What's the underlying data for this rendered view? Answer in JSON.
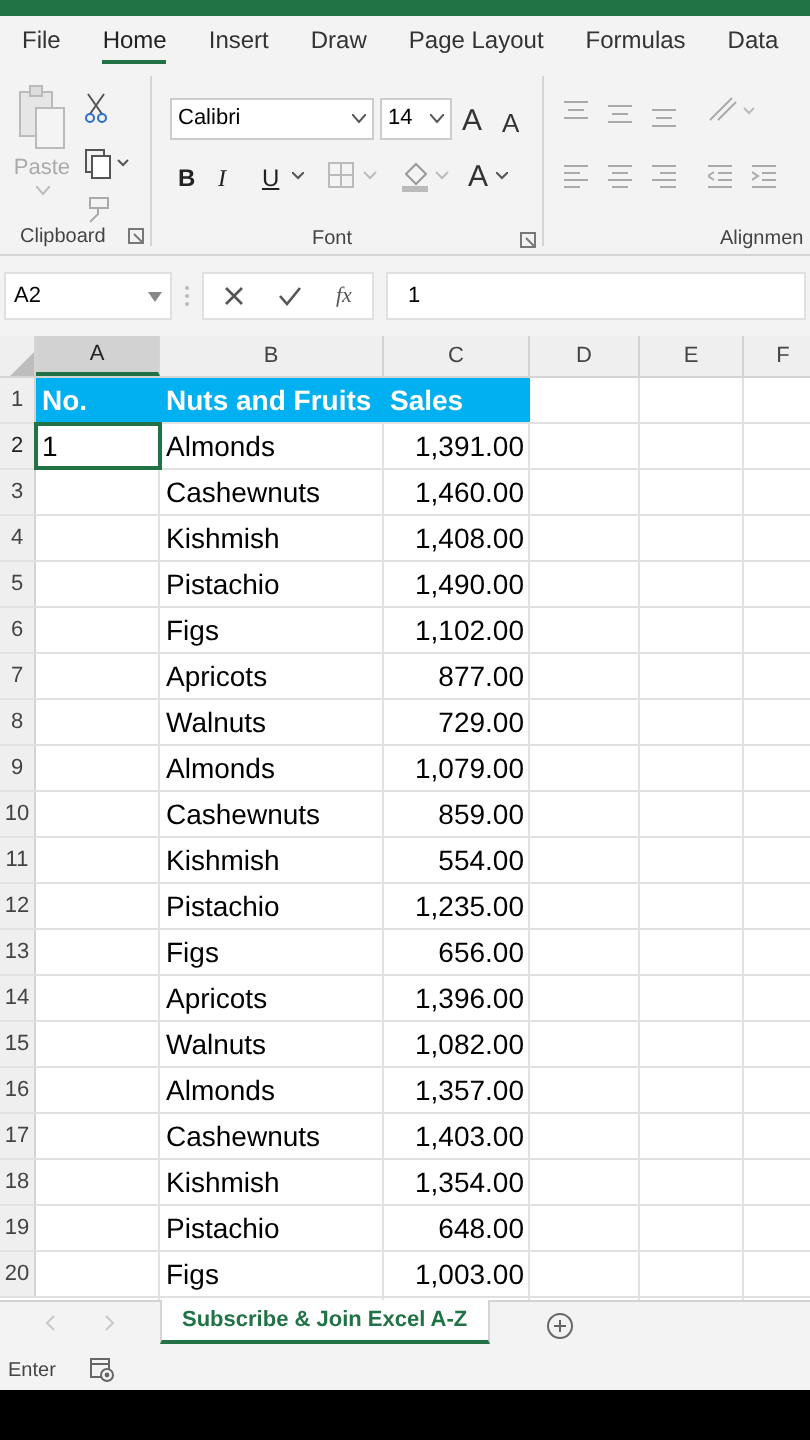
{
  "ribbon_tabs": [
    {
      "label": "File",
      "selected": false
    },
    {
      "label": "Home",
      "selected": true
    },
    {
      "label": "Insert",
      "selected": false
    },
    {
      "label": "Draw",
      "selected": false
    },
    {
      "label": "Page Layout",
      "selected": false
    },
    {
      "label": "Formulas",
      "selected": false
    },
    {
      "label": "Data",
      "selected": false
    }
  ],
  "ribbon": {
    "paste_label": "Paste",
    "font_name": "Calibri",
    "font_size": "14",
    "bold": "B",
    "italic": "I",
    "underline": "U",
    "font_color": "A",
    "grow_font": "A",
    "shrink_font": "A",
    "groups": [
      "Clipboard",
      "Font",
      "Alignmen"
    ]
  },
  "formula_bar": {
    "name_box": "A2",
    "fx": "fx",
    "value": "1"
  },
  "columns": [
    "A",
    "B",
    "C",
    "D",
    "E",
    "F"
  ],
  "header_row": {
    "number": "1",
    "cells": [
      "No.",
      "Nuts and Fruits",
      "Sales"
    ]
  },
  "rows": [
    {
      "number": "2",
      "no": "1",
      "item": "Almonds",
      "sales": "1,391.00",
      "selected": true
    },
    {
      "number": "3",
      "no": "",
      "item": "Cashewnuts",
      "sales": "1,460.00",
      "selected": false
    },
    {
      "number": "4",
      "no": "",
      "item": "Kishmish",
      "sales": "1,408.00",
      "selected": false
    },
    {
      "number": "5",
      "no": "",
      "item": "Pistachio",
      "sales": "1,490.00",
      "selected": false
    },
    {
      "number": "6",
      "no": "",
      "item": "Figs",
      "sales": "1,102.00",
      "selected": false
    },
    {
      "number": "7",
      "no": "",
      "item": "Apricots",
      "sales": "877.00",
      "selected": false
    },
    {
      "number": "8",
      "no": "",
      "item": "Walnuts",
      "sales": "729.00",
      "selected": false
    },
    {
      "number": "9",
      "no": "",
      "item": "Almonds",
      "sales": "1,079.00",
      "selected": false
    },
    {
      "number": "10",
      "no": "",
      "item": "Cashewnuts",
      "sales": "859.00",
      "selected": false
    },
    {
      "number": "11",
      "no": "",
      "item": "Kishmish",
      "sales": "554.00",
      "selected": false
    },
    {
      "number": "12",
      "no": "",
      "item": "Pistachio",
      "sales": "1,235.00",
      "selected": false
    },
    {
      "number": "13",
      "no": "",
      "item": "Figs",
      "sales": "656.00",
      "selected": false
    },
    {
      "number": "14",
      "no": "",
      "item": "Apricots",
      "sales": "1,396.00",
      "selected": false
    },
    {
      "number": "15",
      "no": "",
      "item": "Walnuts",
      "sales": "1,082.00",
      "selected": false
    },
    {
      "number": "16",
      "no": "",
      "item": "Almonds",
      "sales": "1,357.00",
      "selected": false
    },
    {
      "number": "17",
      "no": "",
      "item": "Cashewnuts",
      "sales": "1,403.00",
      "selected": false
    },
    {
      "number": "18",
      "no": "",
      "item": "Kishmish",
      "sales": "1,354.00",
      "selected": false
    },
    {
      "number": "19",
      "no": "",
      "item": "Pistachio",
      "sales": "648.00",
      "selected": false
    },
    {
      "number": "20",
      "no": "",
      "item": "Figs",
      "sales": "1,003.00",
      "selected": false
    }
  ],
  "sheet_tabs": [
    {
      "label": "Subscribe & Join Excel A-Z",
      "selected": true
    }
  ],
  "status_bar": {
    "mode": "Enter"
  }
}
